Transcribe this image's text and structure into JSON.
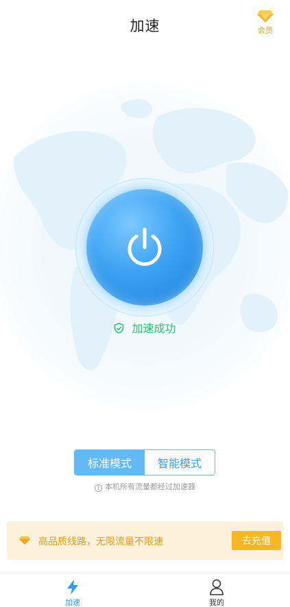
{
  "header": {
    "title": "加速",
    "vip_label": "会员"
  },
  "status": {
    "text": "加速成功"
  },
  "modes": {
    "items": [
      "标准模式",
      "智能模式"
    ],
    "selected": "标准模式"
  },
  "note": {
    "icon": "info-icon",
    "text": "本机所有流量都经过加速器"
  },
  "promo": {
    "icon": "diamond-icon",
    "text": "高品质线路，无限流量不限速",
    "button_label": "去充值"
  },
  "tabbar": {
    "items": [
      {
        "label": "加速",
        "icon": "lightning-icon",
        "active": true
      },
      {
        "label": "我的",
        "icon": "user-icon",
        "active": false
      }
    ]
  },
  "colors": {
    "accent": "#2f9cf0",
    "success": "#2fbf6e",
    "gold": "#f6b81e",
    "promo_bg": "#fdf1dc"
  }
}
